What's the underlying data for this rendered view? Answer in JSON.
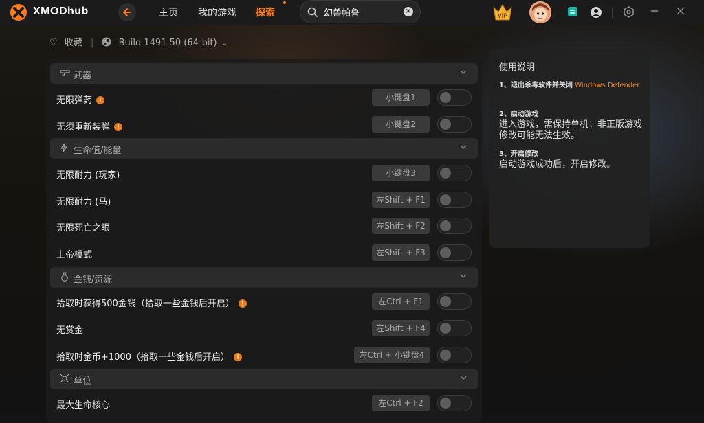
{
  "app": {
    "brand": "XMODhub"
  },
  "nav": {
    "home": "主页",
    "my_games": "我的游戏",
    "explore": "探索"
  },
  "search": {
    "value": "幻兽帕鲁",
    "clear": "×"
  },
  "vip": {
    "label": "VIP"
  },
  "subheader": {
    "favorite": "收藏",
    "build": "Build 1491.50 (64-bit)"
  },
  "categories": [
    {
      "label": "武器",
      "icon": "gun-icon"
    },
    {
      "label": "生命值/能量",
      "icon": "lightning-icon"
    },
    {
      "label": "金钱/资源",
      "icon": "money-bag-icon"
    },
    {
      "label": "单位",
      "icon": "unit-icon"
    }
  ],
  "cheats": [
    {
      "label": "无限弹药",
      "info": true,
      "key": "小键盘1"
    },
    {
      "label": "无须重新装弹",
      "info": true,
      "key": "小键盘2"
    },
    {
      "label": "无限耐力 (玩家)",
      "info": false,
      "key": "小键盘3"
    },
    {
      "label": "无限耐力 (马)",
      "info": false,
      "key": "左Shift + F1"
    },
    {
      "label": "无限死亡之眼",
      "info": false,
      "key": "左Shift + F2"
    },
    {
      "label": "上帝模式",
      "info": false,
      "key": "左Shift + F3"
    },
    {
      "label": "拾取时获得500金钱（拾取一些金钱后开启）",
      "info": true,
      "key": "左Ctrl + F1"
    },
    {
      "label": "无赏金",
      "info": false,
      "key": "左Shift + F4"
    },
    {
      "label": "拾取时金币+1000（拾取一些金钱后开启）",
      "info": true,
      "key": "左Ctrl + 小键盘4"
    },
    {
      "label": "最大生命核心",
      "info": false,
      "key": "左Ctrl + F2"
    }
  ],
  "info_badge": "!",
  "guide": {
    "title": "使用说明",
    "step1_title": "1、退出杀毒软件并关闭",
    "step1_highlight": "Windows Defender",
    "step2_title": "2、启动游戏",
    "step2_body": "进入游戏，需保持单机；非正版游戏修改可能无法生效。",
    "step3_title": "3、开启修改",
    "step3_body": "启动游戏成功后，开启修改。"
  },
  "colors": {
    "accent": "#ff7a1a",
    "panel": "#1b1b1b",
    "key_bg": "#3a3a3a"
  }
}
